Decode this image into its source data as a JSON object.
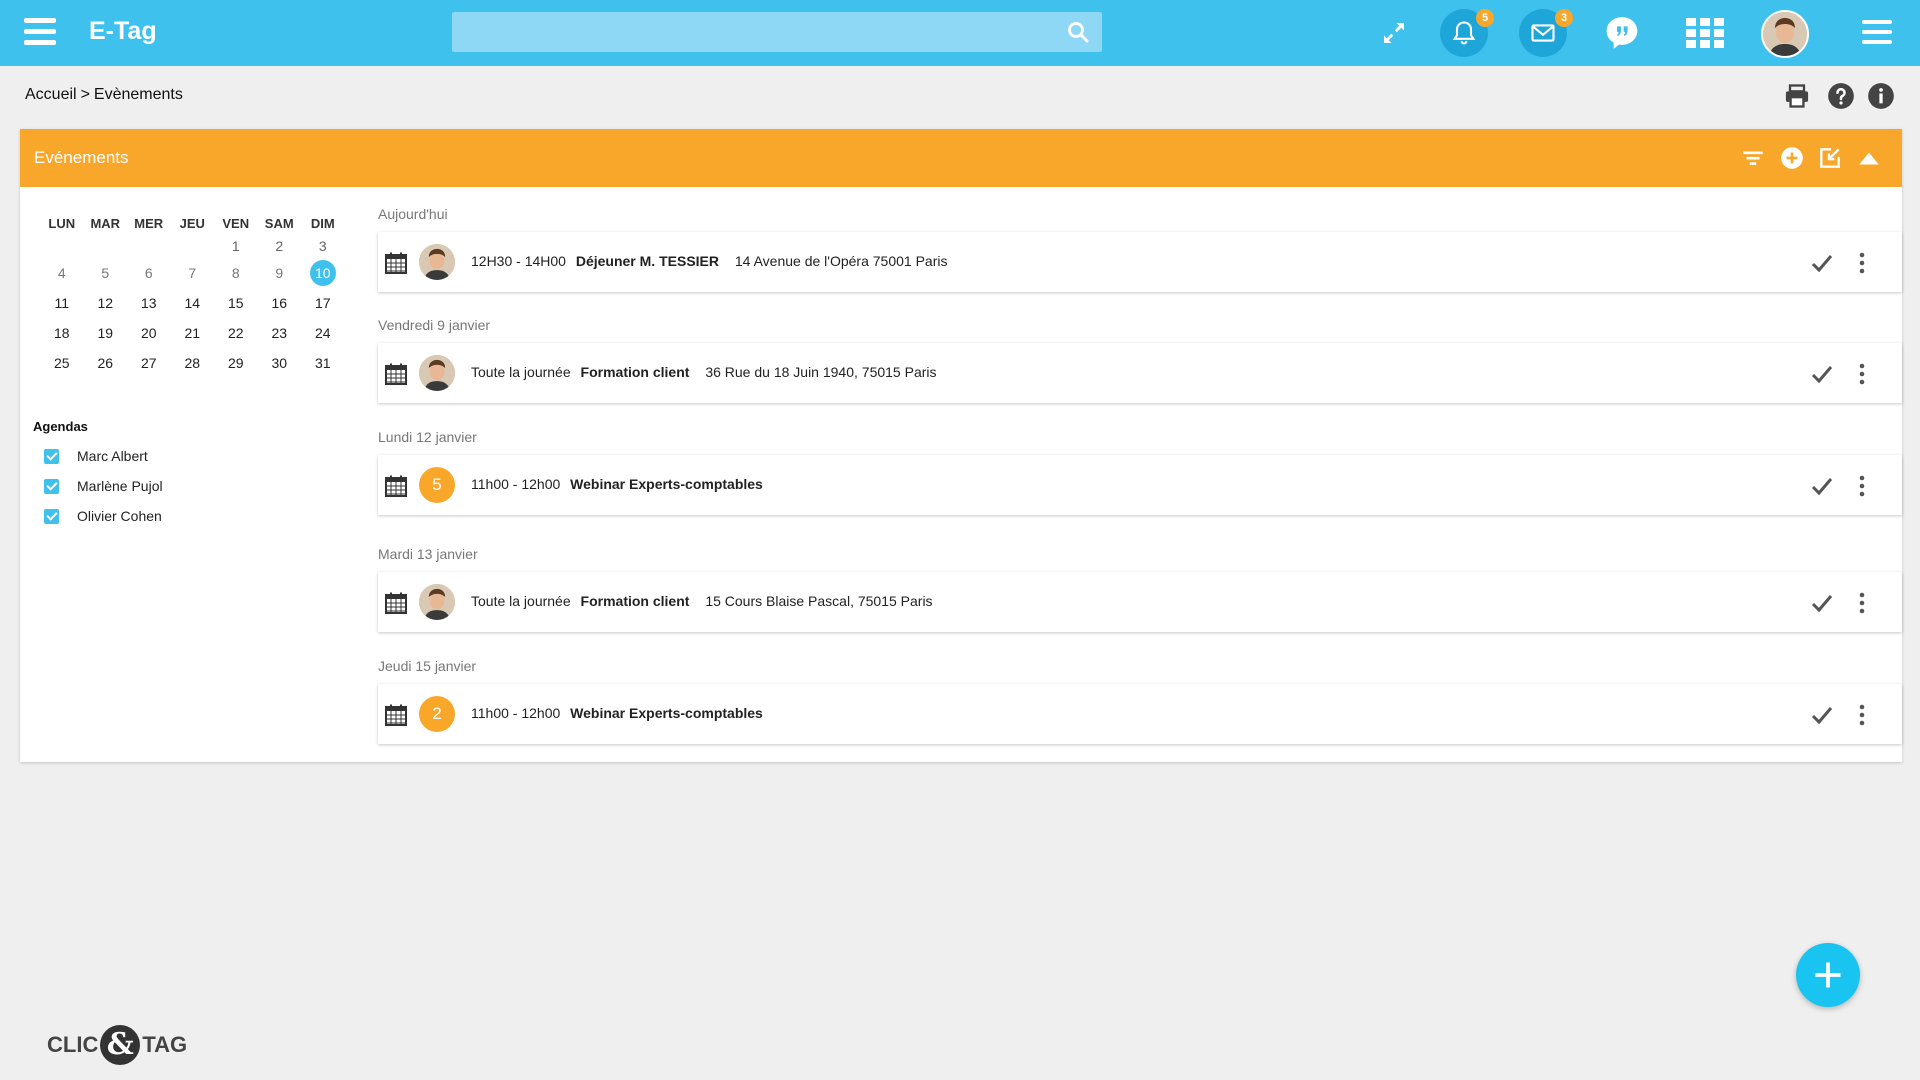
{
  "app": {
    "title": "E-Tag",
    "search_placeholder": "",
    "notifications_count": "5",
    "messages_count": "3"
  },
  "breadcrumb": {
    "home": "Accueil",
    "separator": ">",
    "current": "Evènements"
  },
  "panel": {
    "title": "Evénements"
  },
  "calendar": {
    "weekdays": [
      "LUN",
      "MAR",
      "MER",
      "JEU",
      "VEN",
      "SAM",
      "DIM"
    ],
    "weeks": [
      [
        "",
        "",
        "",
        "",
        "1",
        "2",
        "3"
      ],
      [
        "4",
        "5",
        "6",
        "7",
        "8",
        "9",
        "10"
      ],
      [
        "11",
        "12",
        "13",
        "14",
        "15",
        "16",
        "17"
      ],
      [
        "18",
        "19",
        "20",
        "21",
        "22",
        "23",
        "24"
      ],
      [
        "25",
        "26",
        "27",
        "28",
        "29",
        "30",
        "31"
      ]
    ],
    "today": "10"
  },
  "agendas": {
    "title": "Agendas",
    "items": [
      {
        "label": "Marc Albert",
        "checked": true
      },
      {
        "label": "Marlène Pujol",
        "checked": true
      },
      {
        "label": "Olivier Cohen",
        "checked": true
      }
    ]
  },
  "events": [
    {
      "day": "Aujourd'hui",
      "time": "12H30 - 14H00",
      "title": "Déjeuner M. TESSIER",
      "location": "14 Avenue de l'Opéra 75001 Paris",
      "participant": "avatar",
      "count": ""
    },
    {
      "day": "Vendredi 9 janvier",
      "time": "Toute la journée",
      "title": "Formation client",
      "location": "36 Rue du 18 Juin 1940, 75015 Paris",
      "participant": "avatar",
      "count": ""
    },
    {
      "day": "Lundi 12 janvier",
      "time": "11h00 - 12h00",
      "title": "Webinar Experts-comptables",
      "location": "",
      "participant": "count",
      "count": "5"
    },
    {
      "day": "Mardi 13 janvier",
      "time": "Toute la journée",
      "title": "Formation client",
      "location": "15 Cours Blaise Pascal, 75015 Paris",
      "participant": "avatar",
      "count": ""
    },
    {
      "day": "Jeudi 15 janvier",
      "time": "11h00 - 12h00",
      "title": "Webinar Experts-comptables",
      "location": "",
      "participant": "count",
      "count": "2"
    }
  ],
  "footer": {
    "logo_left": "CLIC",
    "logo_amp": "&",
    "logo_right": "TAG"
  },
  "colors": {
    "topbar": "#3fc1ee",
    "panel_header": "#f9a72b",
    "accent": "#19c4f1"
  }
}
